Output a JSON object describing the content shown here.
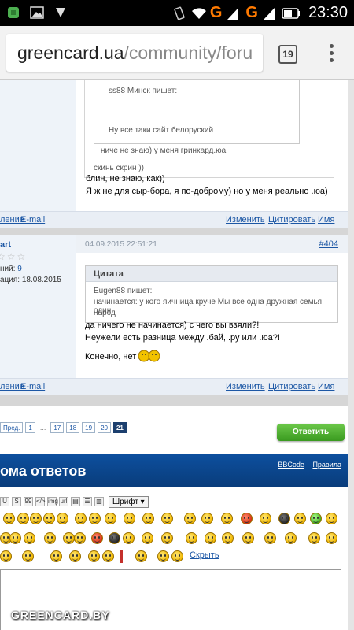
{
  "statusbar": {
    "time": "23:30",
    "signal_label_1": "G",
    "signal_label_2": "G"
  },
  "browser": {
    "url_host": "greencard.ua",
    "url_path": "/community/foru",
    "tabs_count": "19"
  },
  "post1": {
    "nested_quote_author": "ss88 Минск пишет:",
    "nested_quote_text": "Ну все таки сайт белоруский",
    "quote_line_1": "ниче не знаю) у меня гринкард.юа",
    "quote_line_2": "скинь скрин ))",
    "body_line_1": "блин, не знаю, как))",
    "body_line_2": "Я ж не для сыр-бора, я по-доброму) но у меня реально .юа)",
    "left_link_1": "ление",
    "left_link_2": "E-mail",
    "action_edit": "Изменить",
    "action_quote": "Цитировать",
    "action_name": "Имя"
  },
  "post2": {
    "author_fragment": "art",
    "stars_rating": 0,
    "stars_total": 5,
    "replies_label": "ний:",
    "replies_count": "9",
    "registered_label": "ация:",
    "registered_date": "18.08.2015",
    "date": "04.09.2015 22:51:21",
    "number": "#404",
    "quote_title": "Цитата",
    "quote_author": "Eugen88 пишет:",
    "quote_line_1": "начинается: у кого яичница круче Мы все одна дружная семья, один",
    "quote_line_2": "народ",
    "body_line_1": "да ничего не начинается) с чего вы взяли?!",
    "body_line_2": "Неужели есть разница между .бай, .ру или .юа?!",
    "body_line_3": "Конечно, нет",
    "left_link_1": "ление",
    "left_link_2": "E-mail",
    "action_edit": "Изменить",
    "action_quote": "Цитировать",
    "action_name": "Имя"
  },
  "pagination": {
    "prev": "Пред.",
    "first": "1",
    "dots": "...",
    "pages": [
      "17",
      "18",
      "19",
      "20"
    ],
    "current": "21"
  },
  "reply_button": "Ответить",
  "reply_form": {
    "title": "ома ответов",
    "bbcode_link": "BBCode",
    "rules_link": "Правила",
    "toolbar_buttons": [
      "U",
      "S",
      "99",
      "</>",
      "img",
      "url",
      "▤",
      "☰",
      "▥"
    ],
    "font_select": "Шрифт",
    "hide_link": "Скрыть"
  },
  "watermark": "GREENCARD.BY",
  "colors": {
    "link": "#1c57a5",
    "header_blue": "#0d4f9e",
    "reply_green": "#3a9a20"
  }
}
